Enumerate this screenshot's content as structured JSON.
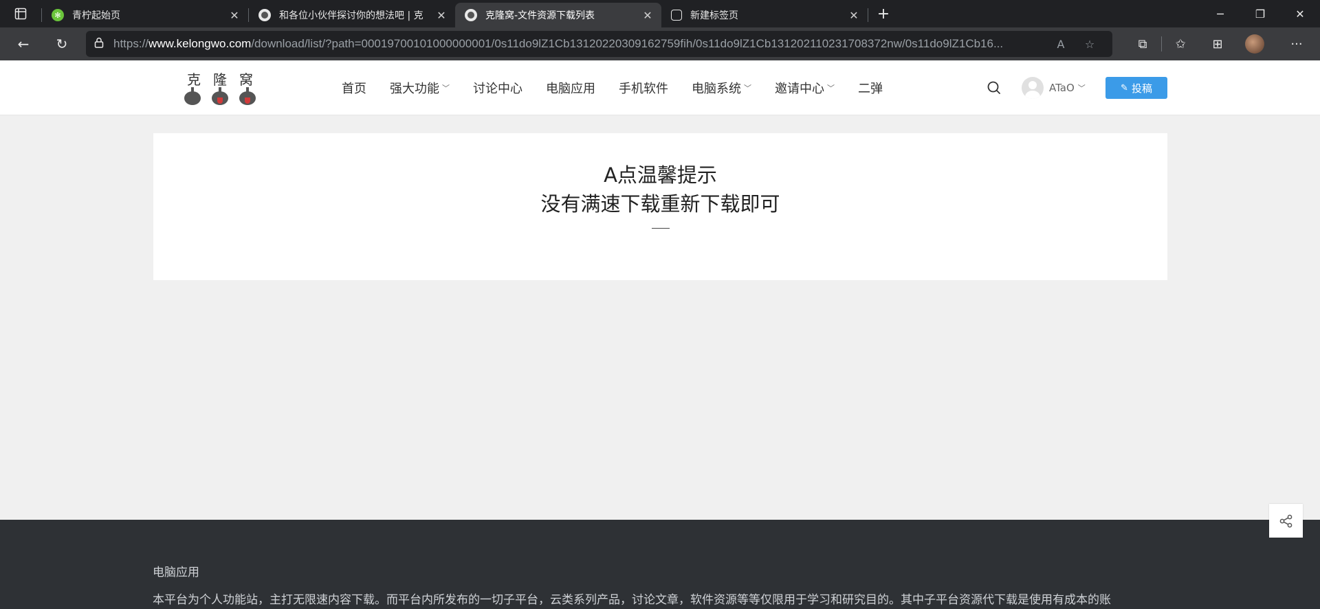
{
  "browser": {
    "tabs": [
      {
        "title": "青柠起始页",
        "favicon_color": "#6ac43b",
        "active": false
      },
      {
        "title": "和各位小伙伴探讨你的想法吧 | 克",
        "favicon_color": "#555555",
        "active": false
      },
      {
        "title": "克隆窝-文件资源下载列表",
        "favicon_color": "#555555",
        "active": true
      },
      {
        "title": "新建标签页",
        "favicon_color": "#3b3c3f",
        "active": false
      }
    ],
    "url_scheme": "https://",
    "url_host": "www.kelongwo.com",
    "url_path": "/download/list/?path=00019700101000000001/0s11do9lZ1Cb13120220309162759fih/0s11do9lZ1Cb131202110231708372nw/0s11do9lZ1Cb16..."
  },
  "site": {
    "logo_chars": [
      "克",
      "隆",
      "窝"
    ],
    "nav": [
      {
        "label": "首页",
        "dropdown": false
      },
      {
        "label": "强大功能",
        "dropdown": true
      },
      {
        "label": "讨论中心",
        "dropdown": false
      },
      {
        "label": "电脑应用",
        "dropdown": false
      },
      {
        "label": "手机软件",
        "dropdown": false
      },
      {
        "label": "电脑系统",
        "dropdown": true
      },
      {
        "label": "邀请中心",
        "dropdown": true
      },
      {
        "label": "二弹",
        "dropdown": false
      }
    ],
    "username": "ATaO",
    "post_button": "投稿",
    "accent_color": "#3b9be8"
  },
  "notice": {
    "title": "A点温馨提示",
    "subtitle": "没有满速下载重新下载即可"
  },
  "footer": {
    "heading": "电脑应用",
    "text": "本平台为个人功能站，主打无限速内容下载。而平台内所发布的一切子平台，云类系列产品，讨论文章，软件资源等等仅限用于学习和研究目的。其中子平台资源代下载是使用有成本的账"
  }
}
